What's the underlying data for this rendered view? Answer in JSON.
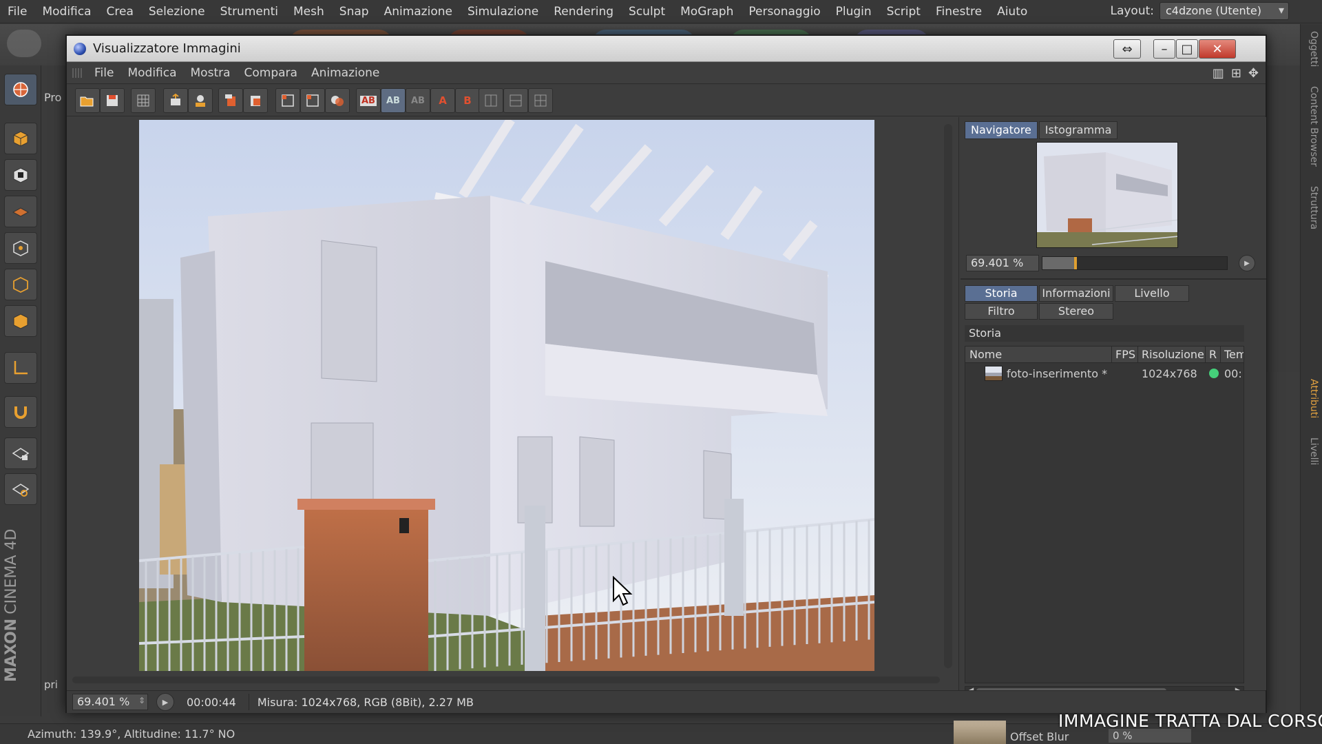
{
  "app_menu": [
    "File",
    "Modifica",
    "Crea",
    "Selezione",
    "Strumenti",
    "Mesh",
    "Snap",
    "Animazione",
    "Simulazione",
    "Rendering",
    "Sculpt",
    "MoGraph",
    "Personaggio",
    "Plugin",
    "Script",
    "Finestre",
    "Aiuto"
  ],
  "layout": {
    "label": "Layout:",
    "value": "c4dzone (Utente)"
  },
  "brand": {
    "maker": "MAXON",
    "product": "CINEMA 4D"
  },
  "right_tabs": [
    "Oggetti",
    "Content Browser",
    "Struttura",
    "Attributi",
    "Livelli"
  ],
  "bg_left_labels": {
    "pro": "Pro",
    "pri": "pri"
  },
  "viewer": {
    "title": "Visualizzatore Immagini",
    "menu": [
      "File",
      "Modifica",
      "Mostra",
      "Compara",
      "Animazione"
    ],
    "toolbar_text": {
      "ab": "AB",
      "a": "A",
      "b": "B"
    },
    "nav_tabs": [
      "Navigatore",
      "Istogramma"
    ],
    "nav_zoom": "69.401 %",
    "nav_zoom_fraction": 0.17,
    "info_tabs_row1": [
      "Storia",
      "Informazioni",
      "Livello"
    ],
    "info_tabs_row2": [
      "Filtro",
      "Stereo"
    ],
    "section": "Storia",
    "table": {
      "headers": [
        "Nome",
        "FPS",
        "Risoluzione",
        "R",
        "Tem"
      ],
      "rows": [
        {
          "name": "foto-inserimento *",
          "fps": "",
          "resolution": "1024x768",
          "r": "green",
          "time": "00:"
        }
      ]
    },
    "bottom": {
      "zoom": "69.401 %",
      "time": "00:00:44",
      "info": "Misura: 1024x768, RGB (8Bit), 2.27 MB"
    }
  },
  "statusbar": "Azimuth: 139.9°, Altitudine: 11.7°  NO",
  "bottom_panel": {
    "label": "Offset Blur",
    "value": "0 %"
  },
  "watermark": "IMMAGINE TRATTA DAL CORSO",
  "colors": {
    "accent_tab": "#5a6f93",
    "status_green": "#45d07a",
    "close_red": "#c0392b",
    "orange_accent": "#e0a030"
  }
}
